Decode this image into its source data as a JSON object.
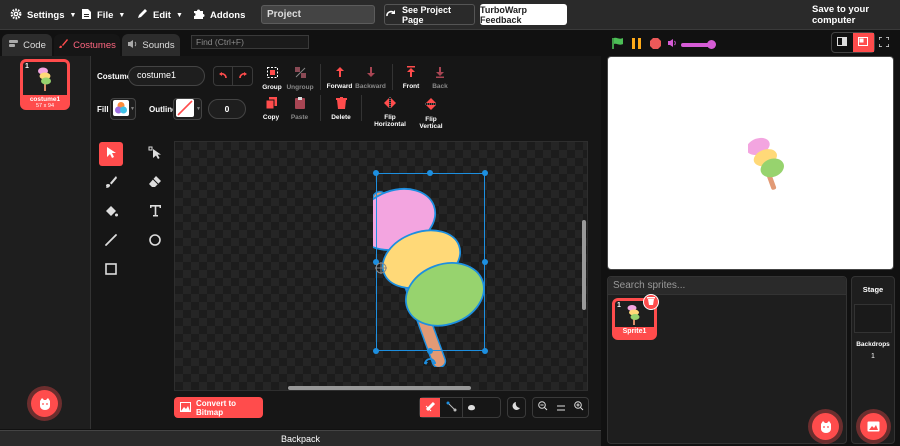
{
  "menubar": {
    "settings": "Settings",
    "file": "File",
    "edit": "Edit",
    "addons": "Addons",
    "project_title": "Project",
    "see_project_page": "See Project Page",
    "turbowarp_feedback": "TurboWarp Feedback",
    "save_to_computer": "Save to your computer"
  },
  "tabs": {
    "code": "Code",
    "costumes": "Costumes",
    "sounds": "Sounds",
    "find_placeholder": "Find (Ctrl+F)"
  },
  "costume_list": [
    {
      "index": "1",
      "name": "costume1",
      "size": "57 x 94"
    }
  ],
  "editor": {
    "costume_label": "Costume",
    "costume_name": "costume1",
    "fill_label": "Fill",
    "outline_label": "Outline",
    "outline_width": "0",
    "group": "Group",
    "ungroup": "Ungroup",
    "forward": "Forward",
    "backward": "Backward",
    "front": "Front",
    "back": "Back",
    "copy": "Copy",
    "paste": "Paste",
    "delete": "Delete",
    "flip_horizontal": "Flip Horizontal",
    "flip_vertical": "Flip Vertical",
    "convert_to_bitmap": "Convert to Bitmap"
  },
  "backpack": "Backpack",
  "sprites": {
    "search_placeholder": "Search sprites...",
    "items": [
      {
        "index": "1",
        "name": "Sprite1"
      }
    ]
  },
  "stage_panel": {
    "title": "Stage",
    "backdrops_label": "Backdrops",
    "backdrops_count": "1"
  },
  "colors": {
    "accent": "#ff4c4c",
    "green_flag": "#4cbf56",
    "pause": "#ffab19",
    "volume": "#d65cd6",
    "selection": "#1d8fe0"
  }
}
